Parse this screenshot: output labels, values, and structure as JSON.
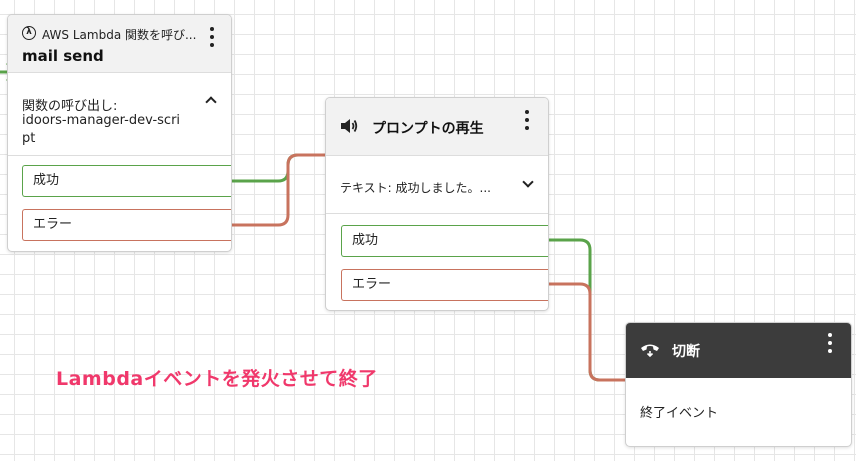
{
  "colors": {
    "success": "#5aa34a",
    "error": "#c8735e",
    "annotation": "#f0386b",
    "dark_header": "#3c3c3c"
  },
  "lambda_block": {
    "icon": "lambda-icon",
    "type_label": "AWS Lambda 関数を呼び...",
    "name": "mail send",
    "detail_label": "関数の呼び出し:",
    "detail_value_line1": "idoors-manager-dev-scri",
    "detail_value_line2": "pt",
    "toggle_icon": "chevron-up-icon",
    "branches": {
      "success": "成功",
      "error": "エラー"
    }
  },
  "prompt_block": {
    "icon": "speaker-icon",
    "title": "プロンプトの再生",
    "text_summary": "テキスト: 成功しました。...",
    "toggle_icon": "chevron-down-icon",
    "branches": {
      "success": "成功",
      "error": "エラー"
    }
  },
  "disconnect_block": {
    "icon": "hang-up-icon",
    "title": "切断",
    "body_text": "終了イベント"
  },
  "annotation": "Lambdaイベントを発火させて終了"
}
